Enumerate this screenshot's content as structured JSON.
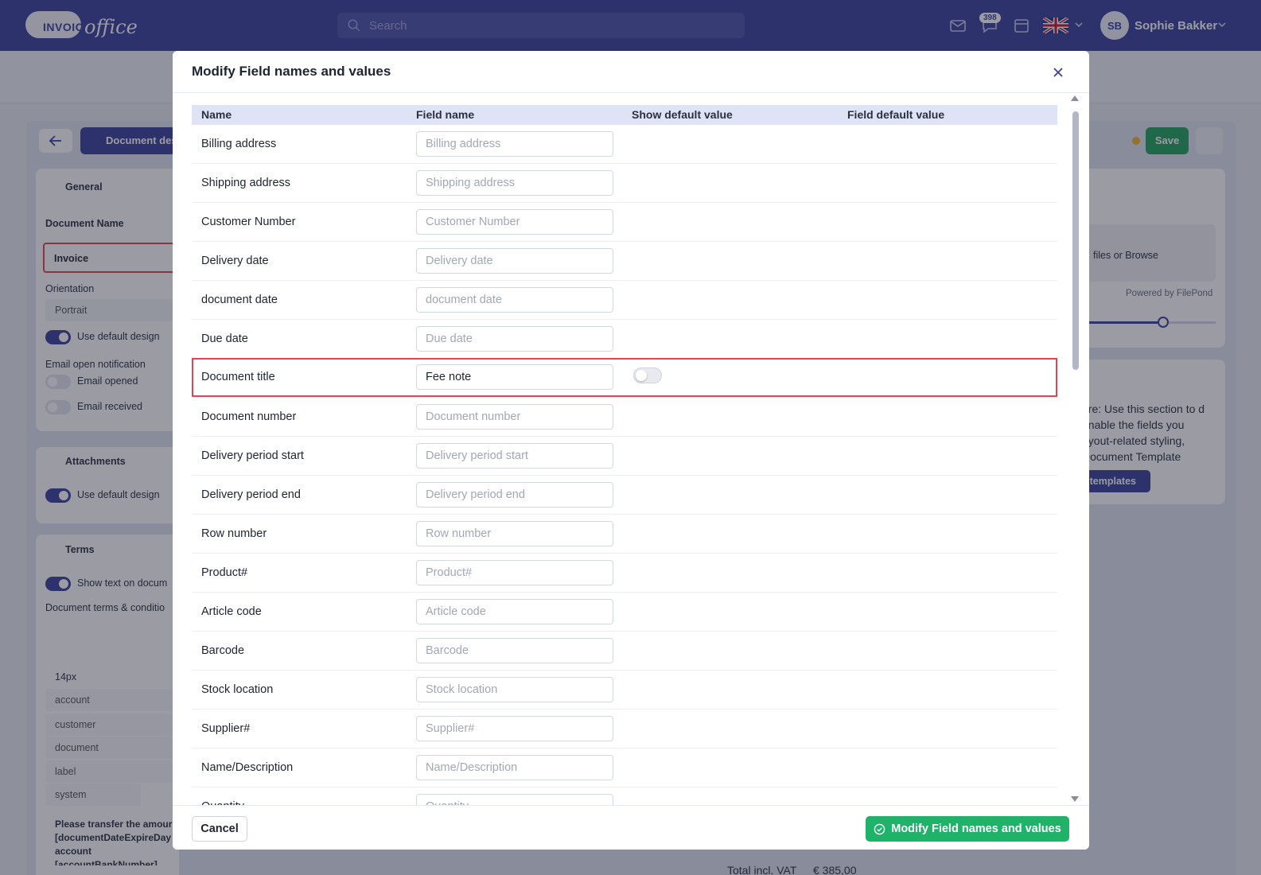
{
  "topbar": {
    "logo_word": "INVOICE",
    "logo_office": "office",
    "search_placeholder": "Search",
    "notification_count": "398",
    "user_initials": "SB",
    "user_name": "Sophie Bakker"
  },
  "background": {
    "doc_tab": "Document design",
    "save_label": "Save",
    "general": "General",
    "document_name_label": "Document Name",
    "document_name_value": "Invoice",
    "orientation_label": "Orientation",
    "orientation_value": "Portrait",
    "use_default_design": "Use default design",
    "email_notification": "Email open notification",
    "email_opened": "Email opened",
    "email_received": "Email received",
    "attachments": "Attachments",
    "use_default_design_2": "Use default design",
    "terms": "Terms",
    "show_text": "Show text on docum",
    "doc_terms_label": "Document terms & conditio",
    "font_size": "14px",
    "tag_account": "account",
    "tag_customer": "customer",
    "tag_document": "document",
    "tag_label": "label",
    "tag_system": "system",
    "terms_text": "Please transfer the amour [documentDateExpireDay account [accountBankNumber] quoting invoice number [documentNumber].",
    "drop_text": "files or Browse",
    "powered_by": "Powered by FilePond",
    "hint_text": "ere: Use this section to d enable the fields you ayout-related styling, Document Template",
    "templates_btn": "t templates",
    "total_label": "Total incl. VAT",
    "total_value": "€ 385,00"
  },
  "modal": {
    "title": "Modify Field names and values",
    "columns": [
      "Name",
      "Field name",
      "Show default value",
      "Field default value"
    ],
    "rows": [
      {
        "name": "Billing address",
        "placeholder": "Billing address",
        "value": ""
      },
      {
        "name": "Shipping address",
        "placeholder": "Shipping address",
        "value": ""
      },
      {
        "name": "Customer Number",
        "placeholder": "Customer Number",
        "value": ""
      },
      {
        "name": "Delivery date",
        "placeholder": "Delivery date",
        "value": ""
      },
      {
        "name": "document date",
        "placeholder": "document date",
        "value": ""
      },
      {
        "name": "Due date",
        "placeholder": "Due date",
        "value": ""
      },
      {
        "name": "Document title",
        "placeholder": "Document title",
        "value": "Fee note",
        "show_default_toggle": false,
        "highlighted": true
      },
      {
        "name": "Document number",
        "placeholder": "Document number",
        "value": ""
      },
      {
        "name": "Delivery period start",
        "placeholder": "Delivery period start",
        "value": ""
      },
      {
        "name": "Delivery period end",
        "placeholder": "Delivery period end",
        "value": ""
      },
      {
        "name": "Row number",
        "placeholder": "Row number",
        "value": ""
      },
      {
        "name": "Product#",
        "placeholder": "Product#",
        "value": ""
      },
      {
        "name": "Article code",
        "placeholder": "Article code",
        "value": ""
      },
      {
        "name": "Barcode",
        "placeholder": "Barcode",
        "value": ""
      },
      {
        "name": "Stock location",
        "placeholder": "Stock location",
        "value": ""
      },
      {
        "name": "Supplier#",
        "placeholder": "Supplier#",
        "value": ""
      },
      {
        "name": "Name/Description",
        "placeholder": "Name/Description",
        "value": ""
      },
      {
        "name": "Quantity",
        "placeholder": "Quantity",
        "value": ""
      }
    ],
    "cancel_label": "Cancel",
    "submit_label": "Modify Field names and values"
  },
  "colors": {
    "brand": "#3a3f9b",
    "success": "#1fb36a",
    "highlight": "#e04552"
  }
}
